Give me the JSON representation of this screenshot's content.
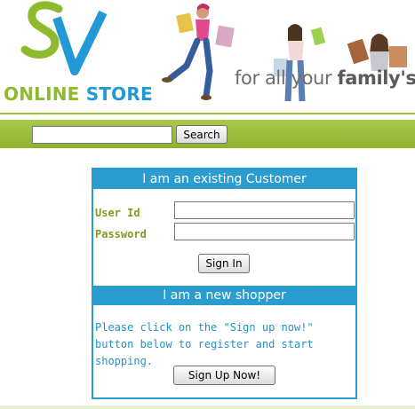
{
  "header": {
    "logo_word1": "ONLINE",
    "logo_word2": "STORE",
    "logo_monogram": "SV",
    "tagline_prefix": "for all your ",
    "tagline_bold": "family's"
  },
  "search": {
    "value": "",
    "placeholder": "",
    "button_label": "Search"
  },
  "login": {
    "existing_heading": "I am an existing Customer",
    "userid_label": "User Id",
    "password_label": "Password",
    "userid_value": "",
    "password_value": "",
    "signin_label": "Sign In"
  },
  "signup": {
    "new_heading": "I am a new shopper",
    "message": "Please click on the \"Sign up now!\" button below to register and start shopping.",
    "button_label": "Sign Up Now!"
  },
  "colors": {
    "brand_green": "#8dbb2d",
    "brand_blue": "#2299d6",
    "panel_blue": "#2a9ccf",
    "label_olive": "#7f9a1e"
  }
}
